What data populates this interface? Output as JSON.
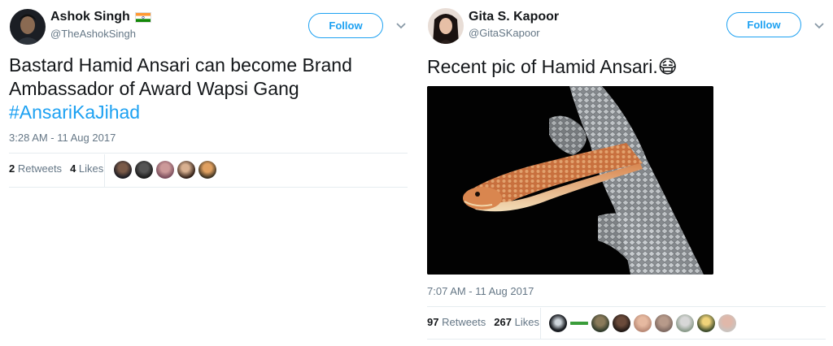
{
  "tweets": [
    {
      "name": "Ashok Singh",
      "handle": "@TheAshokSingh",
      "follow_label": "Follow",
      "text_line1": "Bastard Hamid Ansari can become Brand",
      "text_line2": "Ambassador of Award Wapsi Gang",
      "hashtag": "#AnsariKaJihad",
      "timestamp": "3:28 AM - 11 Aug 2017",
      "retweets_count": "2",
      "retweets_label": "Retweets",
      "likes_count": "4",
      "likes_label": "Likes",
      "icons": {
        "flag": "india-flag-icon",
        "chevron": "chevron-down-icon"
      }
    },
    {
      "name": "Gita S. Kapoor",
      "handle": "@GitaSKapoor",
      "follow_label": "Follow",
      "text": "Recent pic of Hamid Ansari.",
      "emoji": "😷",
      "timestamp": "7:07 AM - 11 Aug 2017",
      "retweets_count": "97",
      "retweets_label": "Retweets",
      "likes_count": "267",
      "likes_label": "Likes",
      "icons": {
        "emoji": "face-with-mask-emoji",
        "chevron": "chevron-down-icon",
        "photo": "snake-shedding-skin-photo"
      }
    }
  ],
  "colors": {
    "accent": "#1da1f2",
    "text": "#14171a",
    "muted": "#657786",
    "border": "#e6ecf0"
  }
}
